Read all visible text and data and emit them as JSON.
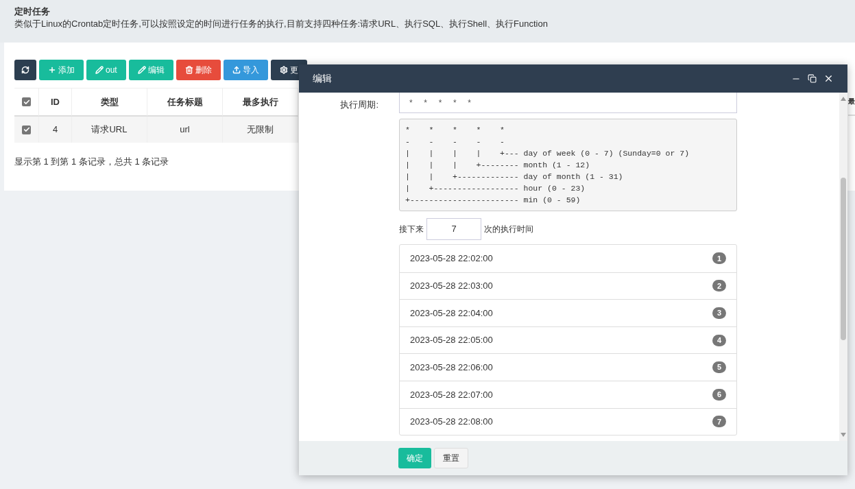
{
  "page": {
    "title": "定时任务",
    "description": "类似于Linux的Crontab定时任务,可以按照设定的时间进行任务的执行,目前支持四种任务:请求URL、执行SQL、执行Shell、执行Function"
  },
  "toolbar": [
    {
      "kind": "dark"
    },
    {
      "kind": "success",
      "label": "添加"
    },
    {
      "kind": "success",
      "label": "out"
    },
    {
      "kind": "success",
      "label": "编辑"
    },
    {
      "kind": "danger",
      "label": "删除"
    },
    {
      "kind": "info",
      "label": "导入"
    },
    {
      "kind": "dark",
      "label": "更"
    }
  ],
  "table": {
    "header_checked": true,
    "columns": [
      "ID",
      "类型",
      "任务标题",
      "最多执行",
      "最"
    ],
    "rows": [
      {
        "checked": true,
        "cells": [
          "4",
          "请求URL",
          "url",
          "无限制"
        ]
      }
    ]
  },
  "pagination_text": "显示第 1 到第 1 条记录，总共 1 条记录",
  "dialog": {
    "title": "编辑",
    "field_label": "执行周期:",
    "field_value": "*     *     *     *     *",
    "help": "*    *    *    *    *\n-    -    -    -    -\n|    |    |    |    +--- day of week (0 - 7) (Sunday=0 or 7)\n|    |    |    +-------- month (1 - 12)\n|    |    +------------- day of month (1 - 31)\n|    +------------------ hour (0 - 23)\n+----------------------- min (0 - 59)",
    "next_prefix": "接下来",
    "next_count": "7",
    "next_suffix": "次的执行时间",
    "runs": [
      {
        "time": "2023-05-28 22:02:00",
        "index": "1"
      },
      {
        "time": "2023-05-28 22:03:00",
        "index": "2"
      },
      {
        "time": "2023-05-28 22:04:00",
        "index": "3"
      },
      {
        "time": "2023-05-28 22:05:00",
        "index": "4"
      },
      {
        "time": "2023-05-28 22:06:00",
        "index": "5"
      },
      {
        "time": "2023-05-28 22:07:00",
        "index": "6"
      },
      {
        "time": "2023-05-28 22:08:00",
        "index": "7"
      }
    ],
    "buttons": [
      {
        "kind": "primary",
        "label": "确定"
      },
      {
        "kind": "default",
        "label": "重置"
      }
    ]
  }
}
